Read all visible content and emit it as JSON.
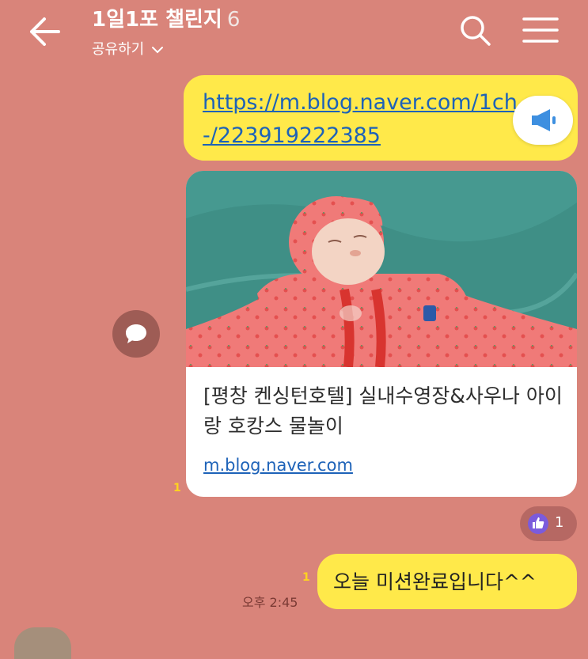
{
  "header": {
    "title": "1일1포 챌린지",
    "member_count": "6",
    "share_label": "공유하기",
    "back_icon": "arrow-left-icon",
    "search_icon": "search-icon",
    "menu_icon": "hamburger-menu-icon"
  },
  "messages": {
    "link_message": {
      "url_text": "https://m.blog.naver.com/1ch...-/223919222385",
      "url_line1": "https://m.blog.naver.com/1ch",
      "url_line2": "-/223919222385",
      "unread_count": "1"
    },
    "link_preview": {
      "title": "[평창 켄싱턴호텔] 실내수영장&사우나 아이랑 호캉스 물놀이",
      "domain": "m.blog.naver.com",
      "image_description": "baby in red strawberry swimsuit floating in pool"
    },
    "reaction": {
      "icon": "thumbs-up-icon",
      "count": "1"
    },
    "text_message": {
      "text": "오늘 미션완료입니다^^",
      "unread_count": "1",
      "time": "오후 2:45"
    }
  },
  "colors": {
    "background": "#d9847a",
    "my_bubble": "#ffe94a",
    "link": "#1d62b8",
    "unread": "#ffd41f",
    "reaction_thumb": "#7b5bdc"
  }
}
